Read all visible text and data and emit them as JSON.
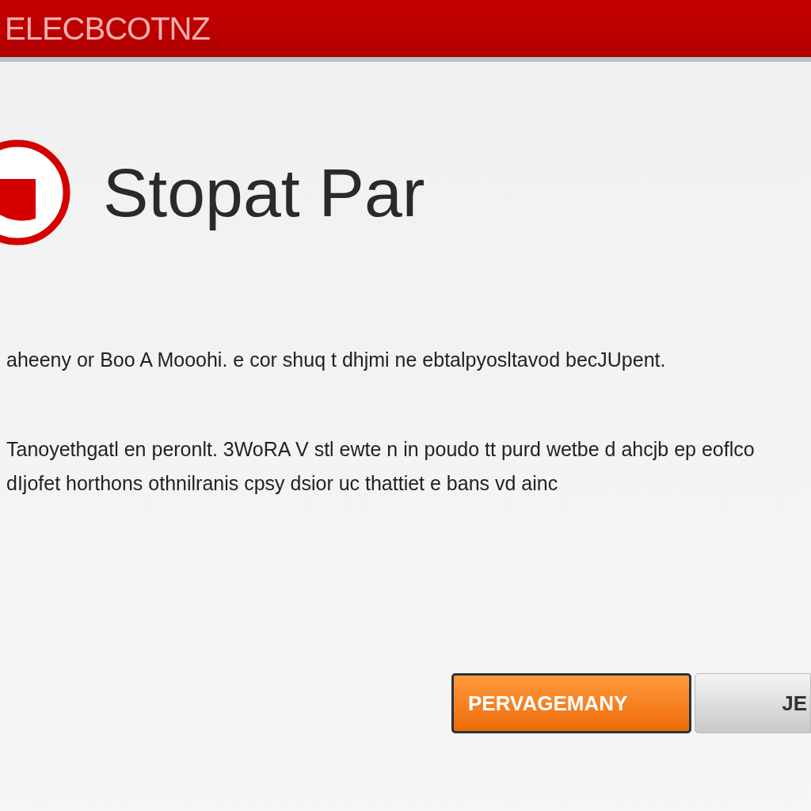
{
  "header": {
    "title": "ELECBCOTNZ"
  },
  "app": {
    "name": "Stopat Par"
  },
  "paragraphs": [
    "aheeny or Boo A Mooohi. e cor shuq t dhjmi ne ebtalpyosltavod becJUpent.",
    "Tanoyethgatl en peronlt. 3WoRA V stl ewte n in poudo tt purd wetbe d ahcjb ep eoflco dIjofet horthons othnilranis cpsy dsior uc thattiet e bans vd ainc"
  ],
  "buttons": [
    {
      "label": "PERVAGEMANY",
      "kind": "primary"
    },
    {
      "label": "JE",
      "kind": "secondary"
    }
  ]
}
